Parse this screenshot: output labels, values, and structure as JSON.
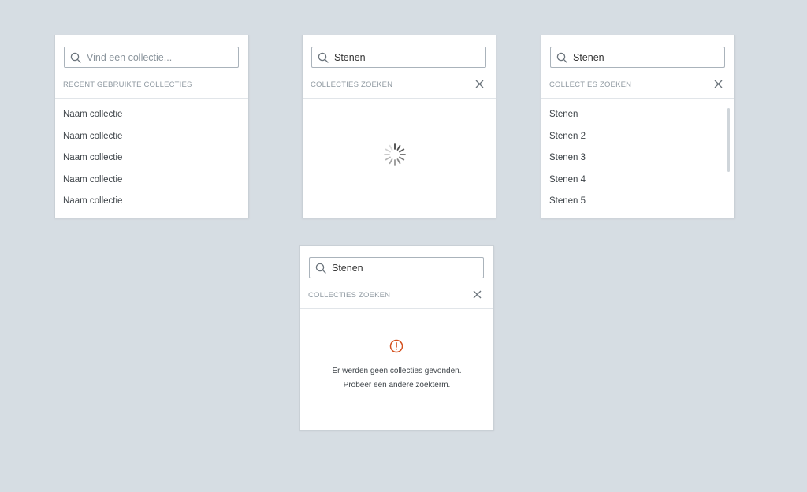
{
  "panel_recent": {
    "search_placeholder": "Vind een collectie...",
    "section_title": "RECENT GEBRUIKTE COLLECTIES",
    "items": [
      "Naam collectie",
      "Naam collectie",
      "Naam collectie",
      "Naam collectie",
      "Naam collectie"
    ]
  },
  "panel_loading": {
    "search_value": "Stenen",
    "section_title": "COLLECTIES ZOEKEN"
  },
  "panel_results": {
    "search_value": "Stenen",
    "section_title": "COLLECTIES ZOEKEN",
    "items": [
      "Stenen",
      "Stenen 2",
      "Stenen 3",
      "Stenen 4",
      "Stenen 5"
    ]
  },
  "panel_empty": {
    "search_value": "Stenen",
    "section_title": "COLLECTIES ZOEKEN",
    "message_line1": "Er werden geen collecties gevonden.",
    "message_line2": "Probeer een andere zoekterm."
  },
  "icons": {
    "search": "search-icon",
    "close": "close-icon",
    "spinner": "loading-spinner-icon",
    "alert": "alert-circle-icon"
  },
  "colors": {
    "background": "#d6dde3",
    "panel": "#ffffff",
    "muted_text": "#8f99a1",
    "body_text": "#3d4348",
    "alert": "#d4501e"
  }
}
